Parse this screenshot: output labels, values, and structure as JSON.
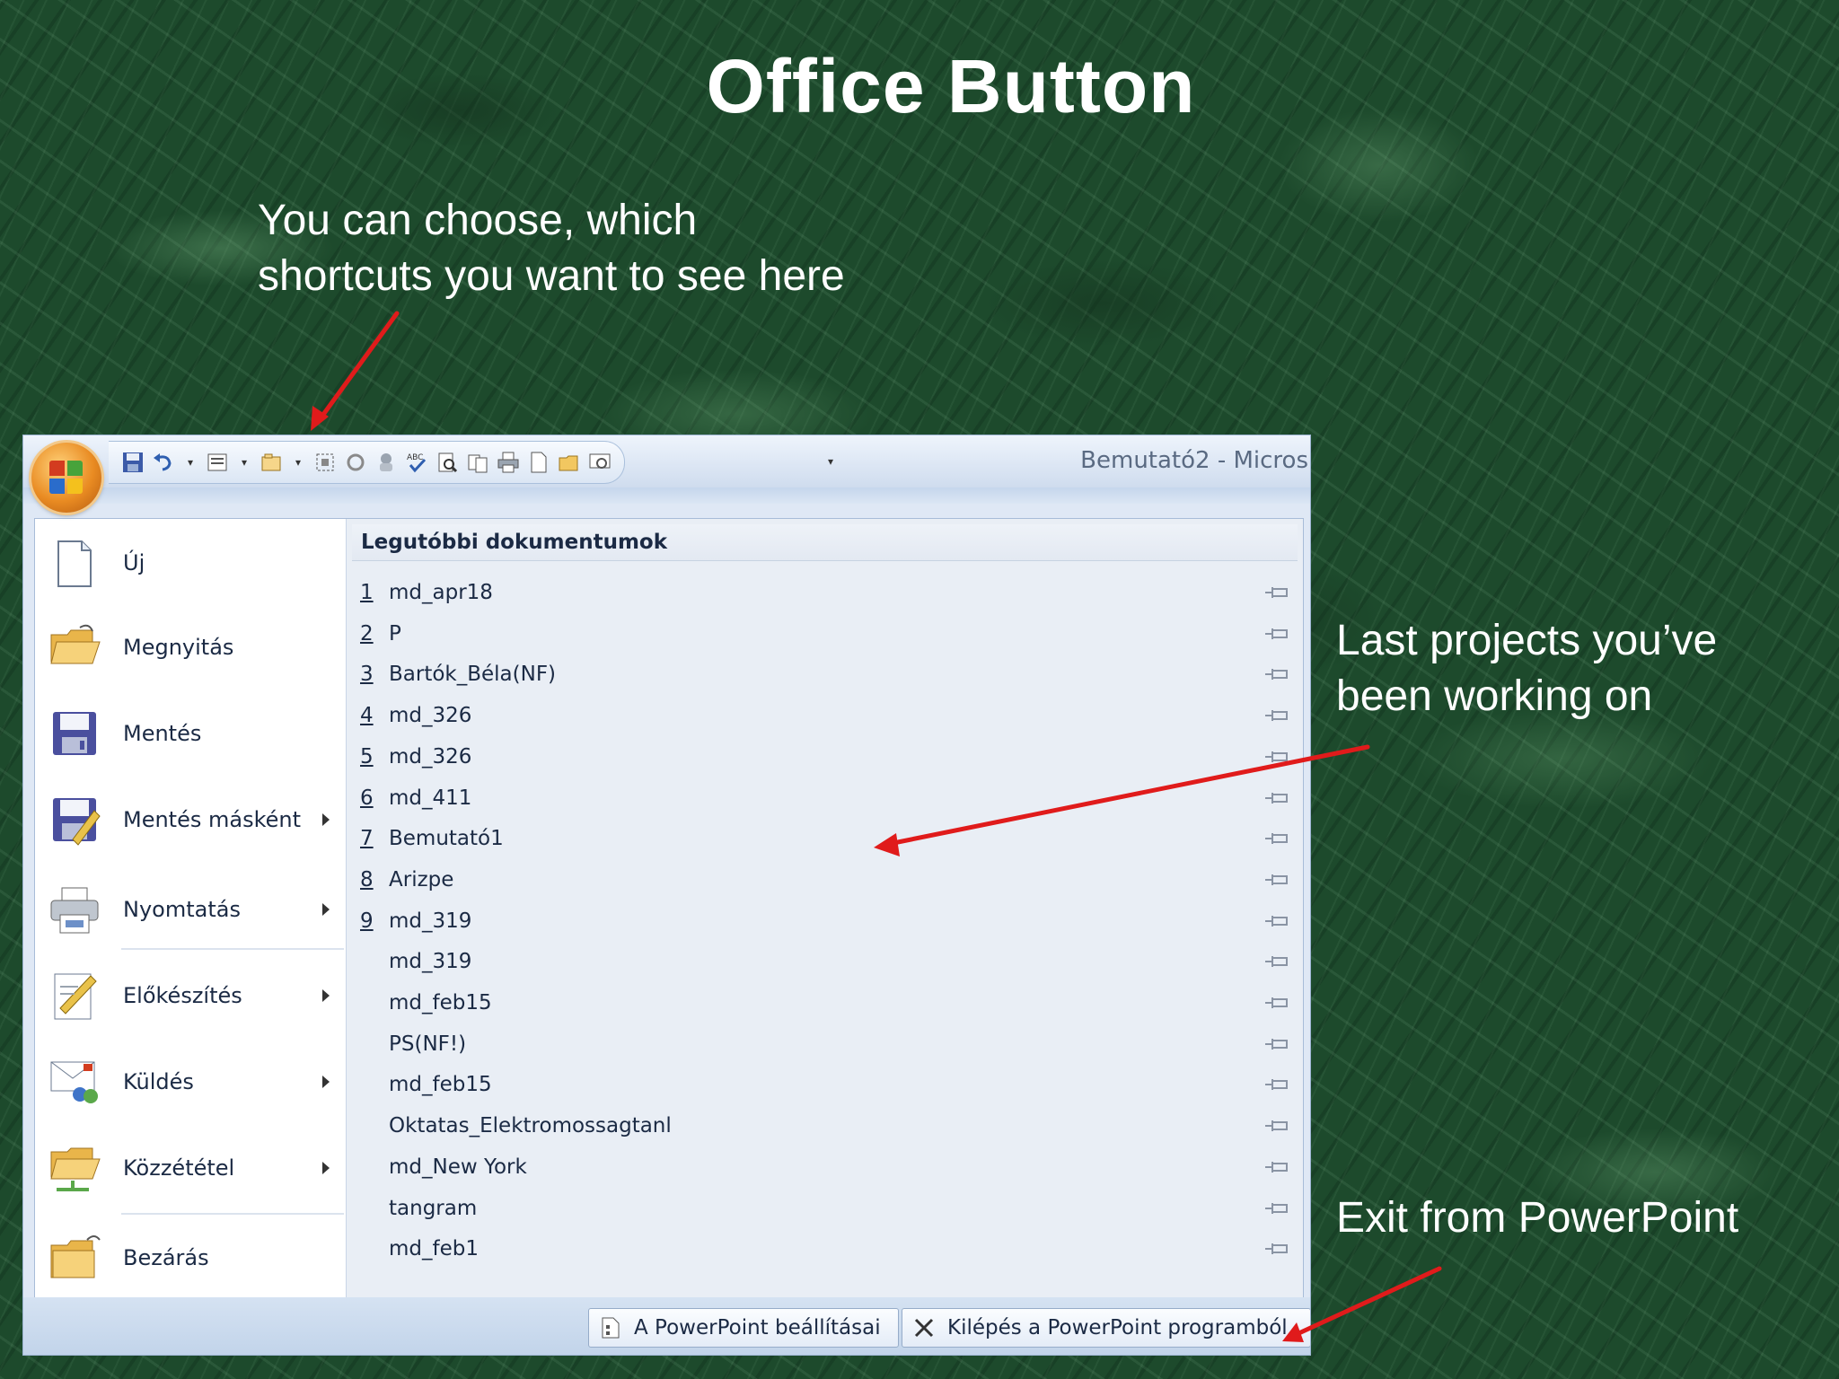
{
  "slide": {
    "title": "Office Button",
    "notes": {
      "shortcuts": [
        "You can choose, which",
        "shortcuts you want to see here"
      ],
      "recent": [
        "Last projects you’ve",
        "been working on"
      ],
      "exit": [
        "Exit from PowerPoint"
      ]
    },
    "arrow_color": "#e01b1b"
  },
  "window": {
    "title": "Bemutató2 - Micros",
    "quick_access_icons": [
      "save-icon",
      "undo-icon",
      "layout-icon",
      "new-slide-icon",
      "select-all-icon",
      "redo-icon",
      "attach-icon",
      "spelling-icon",
      "print-preview-icon",
      "copy-format-icon",
      "print-icon",
      "new-document-icon",
      "open-folder-icon",
      "slideshow-icon",
      "customize-dropdown-icon"
    ]
  },
  "menu": {
    "left_items": [
      {
        "label": "Új",
        "icon": "new-document-icon",
        "submenu": false
      },
      {
        "label": "Megnyitás",
        "icon": "open-folder-icon",
        "submenu": false
      },
      {
        "label": "Mentés",
        "icon": "save-icon",
        "submenu": false
      },
      {
        "label": "Mentés másként",
        "icon": "save-as-icon",
        "submenu": true
      },
      {
        "label": "Nyomtatás",
        "icon": "print-icon",
        "submenu": true
      },
      {
        "label": "Előkészítés",
        "icon": "prepare-icon",
        "submenu": true
      },
      {
        "label": "Küldés",
        "icon": "send-icon",
        "submenu": true
      },
      {
        "label": "Közzététel",
        "icon": "publish-icon",
        "submenu": true
      },
      {
        "label": "Bezárás",
        "icon": "close-folder-icon",
        "submenu": false
      }
    ],
    "recent_header": "Legutóbbi dokumentumok",
    "recent_items": [
      {
        "num": "1",
        "name": "md_apr18"
      },
      {
        "num": "2",
        "name": "P"
      },
      {
        "num": "3",
        "name": "Bartók_Béla(NF)"
      },
      {
        "num": "4",
        "name": "md_326"
      },
      {
        "num": "5",
        "name": "md_326"
      },
      {
        "num": "6",
        "name": "md_411"
      },
      {
        "num": "7",
        "name": "Bemutató1"
      },
      {
        "num": "8",
        "name": "Arizpe"
      },
      {
        "num": "9",
        "name": "md_319"
      },
      {
        "num": "",
        "name": "md_319"
      },
      {
        "num": "",
        "name": "md_feb15"
      },
      {
        "num": "",
        "name": "PS(NF!)"
      },
      {
        "num": "",
        "name": "md_feb15"
      },
      {
        "num": "",
        "name": "Oktatas_Elektromossagtanl"
      },
      {
        "num": "",
        "name": "md_New York"
      },
      {
        "num": "",
        "name": "tangram"
      },
      {
        "num": "",
        "name": "md_feb1"
      }
    ],
    "footer_buttons": {
      "options": "A PowerPoint beállításai",
      "exit": "Kilépés a PowerPoint programból"
    }
  }
}
